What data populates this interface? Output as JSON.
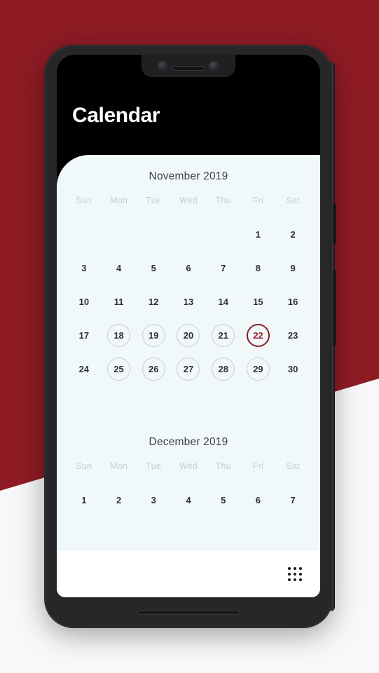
{
  "app": {
    "title": "Calendar",
    "theme": {
      "background_red": "#8E1B24",
      "background_light": "#F8F8FB",
      "header_bg": "#000000",
      "card_bg": "#F0F8FA",
      "accent": "#8E1B24",
      "day_text": "#2C3136",
      "dow_text": "#C5CDD2",
      "circle_outline": "#C9CDD0"
    }
  },
  "weekdays": [
    "Sun",
    "Mon",
    "Tue",
    "Wed",
    "Thu",
    "Fri",
    "Sat"
  ],
  "months": [
    {
      "title": "November 2019",
      "leading_blanks": 5,
      "days": [
        {
          "n": "1",
          "circled": false,
          "today": false
        },
        {
          "n": "2",
          "circled": false,
          "today": false
        },
        {
          "n": "3",
          "circled": false,
          "today": false
        },
        {
          "n": "4",
          "circled": false,
          "today": false
        },
        {
          "n": "5",
          "circled": false,
          "today": false
        },
        {
          "n": "6",
          "circled": false,
          "today": false
        },
        {
          "n": "7",
          "circled": false,
          "today": false
        },
        {
          "n": "8",
          "circled": false,
          "today": false
        },
        {
          "n": "9",
          "circled": false,
          "today": false
        },
        {
          "n": "10",
          "circled": false,
          "today": false
        },
        {
          "n": "11",
          "circled": false,
          "today": false
        },
        {
          "n": "12",
          "circled": false,
          "today": false
        },
        {
          "n": "13",
          "circled": false,
          "today": false
        },
        {
          "n": "14",
          "circled": false,
          "today": false
        },
        {
          "n": "15",
          "circled": false,
          "today": false
        },
        {
          "n": "16",
          "circled": false,
          "today": false
        },
        {
          "n": "17",
          "circled": false,
          "today": false
        },
        {
          "n": "18",
          "circled": true,
          "today": false
        },
        {
          "n": "19",
          "circled": true,
          "today": false
        },
        {
          "n": "20",
          "circled": true,
          "today": false
        },
        {
          "n": "21",
          "circled": true,
          "today": false
        },
        {
          "n": "22",
          "circled": false,
          "today": true
        },
        {
          "n": "23",
          "circled": false,
          "today": false
        },
        {
          "n": "24",
          "circled": false,
          "today": false
        },
        {
          "n": "25",
          "circled": true,
          "today": false
        },
        {
          "n": "26",
          "circled": true,
          "today": false
        },
        {
          "n": "27",
          "circled": true,
          "today": false
        },
        {
          "n": "28",
          "circled": true,
          "today": false
        },
        {
          "n": "29",
          "circled": true,
          "today": false
        },
        {
          "n": "30",
          "circled": false,
          "today": false
        }
      ]
    },
    {
      "title": "December 2019",
      "leading_blanks": 0,
      "days": [
        {
          "n": "1",
          "circled": false,
          "today": false
        },
        {
          "n": "2",
          "circled": false,
          "today": false
        },
        {
          "n": "3",
          "circled": false,
          "today": false
        },
        {
          "n": "4",
          "circled": false,
          "today": false
        },
        {
          "n": "5",
          "circled": false,
          "today": false
        },
        {
          "n": "6",
          "circled": false,
          "today": false
        },
        {
          "n": "7",
          "circled": false,
          "today": false
        }
      ]
    }
  ],
  "bottom_bar": {
    "apps_icon": "apps-grid-icon"
  }
}
